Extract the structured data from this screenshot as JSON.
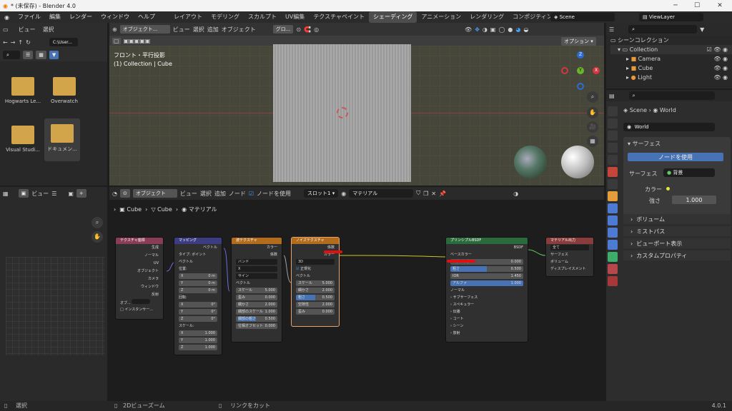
{
  "title_bar": {
    "title": "* (未保存) - Blender 4.0"
  },
  "menu": [
    "ファイル",
    "編集",
    "レンダー",
    "ウィンドウ",
    "ヘルプ"
  ],
  "workspaces": [
    "レイアウト",
    "モデリング",
    "スカルプト",
    "UV編集",
    "テクスチャペイント",
    "シェーディング",
    "アニメーション",
    "レンダリング",
    "コンポジティング"
  ],
  "active_workspace": "シェーディング",
  "scene": "Scene",
  "view_layer": "ViewLayer",
  "file_browser": {
    "menu": [
      "ビュー",
      "選択"
    ],
    "path": "C:\\User...",
    "items": [
      "Hogwarts Le...",
      "Overwatch",
      "Visual Studi...",
      "ドキュメン..."
    ]
  },
  "viewport": {
    "mode": "オブジェクト...",
    "menu": [
      "ビュー",
      "選択",
      "追加",
      "オブジェクト"
    ],
    "transform": "グロ...",
    "options": "オプション",
    "info1": "フロント・平行投影",
    "info2": "(1) Collection | Cube",
    "axes": [
      "X",
      "Y",
      "Z"
    ]
  },
  "outliner": {
    "title": "シーンコレクション",
    "items": [
      "Collection",
      "Camera",
      "Cube",
      "Light"
    ]
  },
  "properties": {
    "breadcrumb": [
      "Scene",
      "World"
    ],
    "world": "World",
    "surface_panel": "サーフェス",
    "use_nodes": "ノードを使用",
    "surface_label": "サーフェス",
    "surface_value": "背景",
    "color_label": "カラー",
    "strength_label": "強さ",
    "strength_value": "1.000",
    "panels": [
      "ボリューム",
      "ミストパス",
      "ビューポート表示",
      "カスタムプロパティ"
    ]
  },
  "image_editor": {
    "menu": [
      "ビュー"
    ]
  },
  "node_editor": {
    "mode": "オブジェクト",
    "menu": [
      "ビュー",
      "選択",
      "追加",
      "ノード"
    ],
    "use_nodes": "ノードを使用",
    "slot": "スロット1",
    "material": "マテリアル",
    "breadcrumb": [
      "Cube",
      "Cube",
      "マテリアル"
    ]
  },
  "nodes": {
    "texcoord": {
      "title": "テクスチャ座標",
      "outputs": [
        "生成",
        "ノーマル",
        "UV",
        "オブジェクト",
        "カメラ",
        "ウィンドウ",
        "反射"
      ],
      "obj": "オブ...",
      "inst": "インスタンサー..."
    },
    "mapping": {
      "title": "マッピング",
      "out": "ベクトル",
      "type_label": "タイプ:",
      "type": "ポイント",
      "vec": "ベクトル",
      "loc": "位置:",
      "rot": "回転:",
      "scale": "スケール:",
      "x": "X",
      "y": "Y",
      "z": "Z",
      "loc_vals": [
        "0 m",
        "0 m",
        "0 m"
      ],
      "rot_vals": [
        "0°",
        "0°",
        "0°"
      ],
      "scale_vals": [
        "1.000",
        "1.000",
        "1.000"
      ]
    },
    "wave": {
      "title": "波テクスチャ",
      "outputs": [
        "カラー",
        "係数"
      ],
      "band": "バンド",
      "axis": "X",
      "profile": "サイン",
      "vec": "ベクトル",
      "rows": [
        [
          "スケール",
          "5.000"
        ],
        [
          "歪み",
          "0.000"
        ],
        [
          "細かさ",
          "2.000"
        ],
        [
          "細部のスケール",
          "1.000"
        ],
        [
          "細部の粗さ",
          "0.500"
        ],
        [
          "位相オフセット",
          "0.000"
        ]
      ]
    },
    "noise": {
      "title": "ノイズテクスチャ",
      "outputs": [
        "係数",
        "カラー"
      ],
      "dim": "3D",
      "norm": "正規化",
      "vec": "ベクトル",
      "rows": [
        [
          "スケール",
          "5.000"
        ],
        [
          "細かさ",
          "2.000"
        ],
        [
          "粗さ",
          "0.500"
        ],
        [
          "空隙性",
          "2.000"
        ],
        [
          "歪み",
          "0.000"
        ]
      ]
    },
    "bsdf": {
      "title": "プリンシプルBSDF",
      "out": "BSDF",
      "base": "ベースカラー",
      "rows": [
        [
          "メタリック",
          "0.000"
        ],
        [
          "粗さ",
          "0.500"
        ],
        [
          "IOR",
          "1.450"
        ],
        [
          "アルファ",
          "1.000"
        ]
      ],
      "normal": "ノーマル",
      "subs": [
        "サブサーフェス",
        "スペキュラー",
        "伝播",
        "コート",
        "シーン",
        "放射"
      ]
    },
    "output": {
      "title": "マテリアル出力",
      "target": "全て",
      "inputs": [
        "サーフェス",
        "ボリューム",
        "ディスプレイスメント"
      ]
    }
  },
  "status": {
    "left": "選択",
    "mid": "2Dビューズーム",
    "right": "リンクをカット",
    "version": "4.0.1"
  }
}
